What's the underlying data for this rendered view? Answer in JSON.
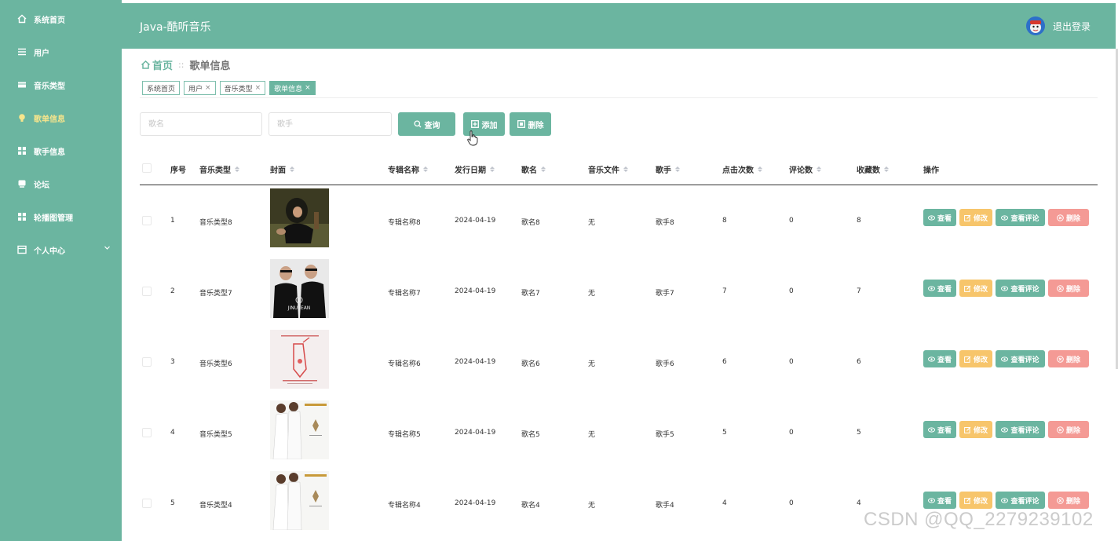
{
  "sidebar": {
    "items": [
      {
        "label": "系统首页",
        "icon": "home-icon"
      },
      {
        "label": "用户",
        "icon": "list-icon"
      },
      {
        "label": "音乐类型",
        "icon": "card-icon"
      },
      {
        "label": "歌单信息",
        "icon": "bulb-icon"
      },
      {
        "label": "歌手信息",
        "icon": "grid-icon"
      },
      {
        "label": "论坛",
        "icon": "chat-icon"
      },
      {
        "label": "轮播图管理",
        "icon": "grid-icon"
      },
      {
        "label": "个人中心",
        "icon": "id-card-icon"
      }
    ],
    "active_index": 3,
    "active_color": "#f7e58c"
  },
  "header": {
    "brand": "Java-酷听音乐",
    "logout": "退出登录"
  },
  "breadcrumb": {
    "home": "首页",
    "current": "歌单信息"
  },
  "tags": [
    {
      "label": "系统首页",
      "closable": false
    },
    {
      "label": "用户",
      "closable": true
    },
    {
      "label": "音乐类型",
      "closable": true
    },
    {
      "label": "歌单信息",
      "closable": true,
      "active": true
    }
  ],
  "search": {
    "name_placeholder": "歌名",
    "singer_placeholder": "歌手",
    "query_label": "查询",
    "add_label": "添加",
    "delete_label": "删除"
  },
  "table": {
    "columns": [
      "序号",
      "音乐类型",
      "封面",
      "专辑名称",
      "发行日期",
      "歌名",
      "音乐文件",
      "歌手",
      "点击次数",
      "评论数",
      "收藏数",
      "操作"
    ],
    "rows": [
      {
        "index": "1",
        "type": "音乐类型8",
        "album": "专辑名称8",
        "date": "2024-04-19",
        "song": "歌名8",
        "file": "无",
        "singer": "歌手8",
        "clicks": "8",
        "comments": "0",
        "favorites": "8"
      },
      {
        "index": "2",
        "type": "音乐类型7",
        "album": "专辑名称7",
        "date": "2024-04-19",
        "song": "歌名7",
        "file": "无",
        "singer": "歌手7",
        "clicks": "7",
        "comments": "0",
        "favorites": "7"
      },
      {
        "index": "3",
        "type": "音乐类型6",
        "album": "专辑名称6",
        "date": "2024-04-19",
        "song": "歌名6",
        "file": "无",
        "singer": "歌手6",
        "clicks": "6",
        "comments": "0",
        "favorites": "6"
      },
      {
        "index": "4",
        "type": "音乐类型5",
        "album": "专辑名称5",
        "date": "2024-04-19",
        "song": "歌名5",
        "file": "无",
        "singer": "歌手5",
        "clicks": "5",
        "comments": "0",
        "favorites": "5"
      },
      {
        "index": "5",
        "type": "音乐类型4",
        "album": "专辑名称4",
        "date": "2024-04-19",
        "song": "歌名4",
        "file": "无",
        "singer": "歌手4",
        "clicks": "4",
        "comments": "0",
        "favorites": "4"
      }
    ],
    "actions": {
      "view": "查看",
      "edit": "修改",
      "comments": "查看评论",
      "delete": "删除"
    },
    "cover_text": {
      "jinusean": "JINUSEAN"
    }
  },
  "colors": {
    "primary": "#6bb5a0",
    "edit": "#f7c56b",
    "delete": "#f49a95"
  },
  "watermark": "CSDN @QQ_2279239102"
}
